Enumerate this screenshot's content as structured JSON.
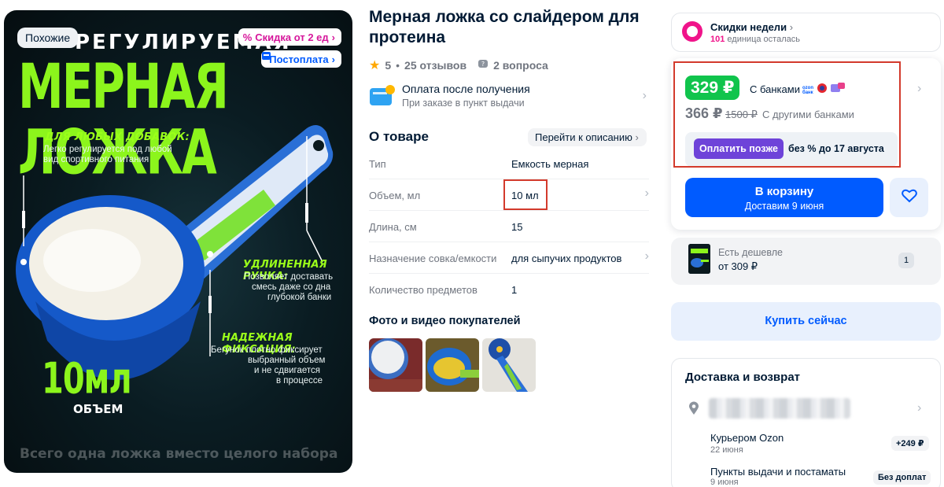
{
  "image": {
    "similar_badge": "Похожие",
    "discount_pill": "Скидка от 2 ед",
    "postpay_pill": "Постоплата",
    "headline_small": "РЕГУЛИРУЕМАЯ",
    "headline_big": "МЕРНАЯ ЛОЖКА",
    "callout1_title": "ДЛЯ ЛЮБЫХ ДОБАВОК:",
    "callout1_text_1": "Легко регулируется под любой",
    "callout1_text_2": "вид спортивного питания",
    "callout2_title": "УДЛИНЕННАЯ РУЧКА:",
    "callout2_text_1": "Позволяет доставать",
    "callout2_text_2": "смесь даже со дна",
    "callout2_text_3": "глубокой банки",
    "callout3_title": "НАДЕЖНАЯ ФИКСАЦИЯ:",
    "callout3_text_1": "Бегунок плотно фиксирует",
    "callout3_text_2": "выбранный объем",
    "callout3_text_3": "и не сдвигается",
    "callout3_text_4": "в процессе",
    "volume_big": "10мл",
    "volume_label": "ОБЪЕМ",
    "footer_text": "Всего одна ложка вместо целого набора"
  },
  "product": {
    "title": "Мерная ложка со слайдером для протеина",
    "rating": "5",
    "reviews": "25 отзывов",
    "questions": "2 вопроса",
    "pay_after_title": "Оплата после получения",
    "pay_after_sub": "При заказе в пункт выдачи"
  },
  "about": {
    "heading": "О товаре",
    "goto_description": "Перейти к описанию",
    "specs": [
      {
        "key": "Тип",
        "value": "Емкость мерная"
      },
      {
        "key": "Объем, мл",
        "value": "10 мл"
      },
      {
        "key": "Длина, см",
        "value": "15"
      },
      {
        "key": "Назначение совка/емкости",
        "value": "для сыпучих продуктов"
      },
      {
        "key": "Количество предметов",
        "value": "1"
      }
    ]
  },
  "photos": {
    "heading": "Фото и видео покупателей"
  },
  "week": {
    "title": "Скидки недели",
    "chevron": "›",
    "count": "101",
    "count_text": "единица осталась"
  },
  "price": {
    "green": "329 ₽",
    "with_banks": "С банками",
    "ozon_bank_1": "ozon",
    "ozon_bank_2": "банк",
    "old_price": "366 ₽",
    "strike_price": "1500 ₽",
    "other_banks": "С другими банками",
    "pay_later_button": "Оплатить позже",
    "pay_later_text": "без % до 17 августа",
    "cart_button": "В корзину",
    "cart_sub": "Доставим 9 июня"
  },
  "cheaper": {
    "title": "Есть дешевле",
    "price": "от 309 ₽",
    "count": "1"
  },
  "buy_now": "Купить сейчас",
  "delivery": {
    "heading": "Доставка и возврат",
    "courier": "Курьером Ozon",
    "courier_date": "22 июня",
    "courier_price": "+249 ₽",
    "pickup": "Пункты выдачи и постаматы",
    "pickup_date": "9 июня",
    "pickup_price": "Без доплат"
  },
  "colors": {
    "accent_blue": "#005bff",
    "green_price": "#10c44c",
    "highlight_red": "#d33a2c",
    "pay_later_purple": "#6e43d9",
    "week_pink": "#f0148a",
    "image_neon_green": "#9bff1a"
  }
}
